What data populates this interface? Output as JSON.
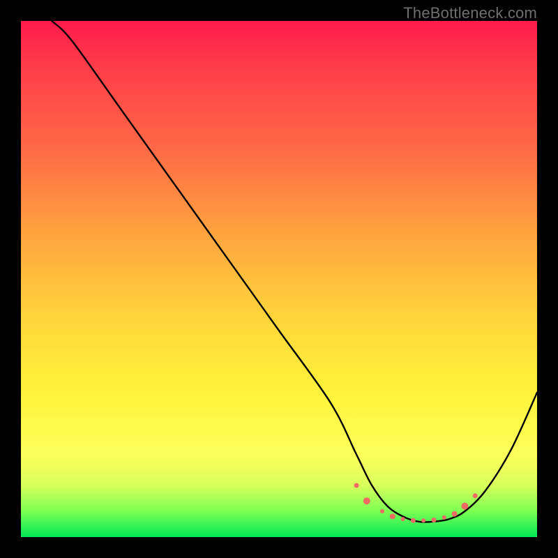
{
  "watermark": {
    "text": "TheBottleneck.com"
  },
  "chart_data": {
    "type": "line",
    "title": "",
    "xlabel": "",
    "ylabel": "",
    "xlim": [
      0,
      100
    ],
    "ylim": [
      0,
      100
    ],
    "grid": false,
    "legend": false,
    "series": [
      {
        "name": "bottleneck-curve",
        "color": "#000000",
        "x": [
          6,
          10,
          20,
          30,
          40,
          50,
          60,
          65,
          68,
          71,
          74,
          77,
          80,
          83,
          86,
          90,
          95,
          100
        ],
        "y": [
          100,
          96,
          82,
          68,
          54,
          40,
          26,
          16,
          10,
          6,
          4,
          3,
          3,
          3.5,
          5,
          9,
          17,
          28
        ]
      }
    ],
    "markers": {
      "name": "highlighted-points",
      "color": "#ed6b63",
      "points": [
        {
          "x": 65,
          "y": 10,
          "r": 3.5
        },
        {
          "x": 67,
          "y": 7,
          "r": 5
        },
        {
          "x": 70,
          "y": 5,
          "r": 3
        },
        {
          "x": 72,
          "y": 4,
          "r": 4
        },
        {
          "x": 74,
          "y": 3.5,
          "r": 3
        },
        {
          "x": 76,
          "y": 3.2,
          "r": 3.5
        },
        {
          "x": 78,
          "y": 3.2,
          "r": 3
        },
        {
          "x": 80,
          "y": 3.3,
          "r": 3.5
        },
        {
          "x": 82,
          "y": 3.8,
          "r": 3
        },
        {
          "x": 84,
          "y": 4.5,
          "r": 4
        },
        {
          "x": 86,
          "y": 6,
          "r": 5
        },
        {
          "x": 88,
          "y": 8,
          "r": 3.5
        }
      ]
    },
    "gradient_stops": [
      {
        "pos": 0,
        "color": "#ff1a4d"
      },
      {
        "pos": 25,
        "color": "#ff6a46"
      },
      {
        "pos": 50,
        "color": "#ffc63a"
      },
      {
        "pos": 75,
        "color": "#fff23a"
      },
      {
        "pos": 95,
        "color": "#7cff52"
      },
      {
        "pos": 100,
        "color": "#00e858"
      }
    ]
  }
}
